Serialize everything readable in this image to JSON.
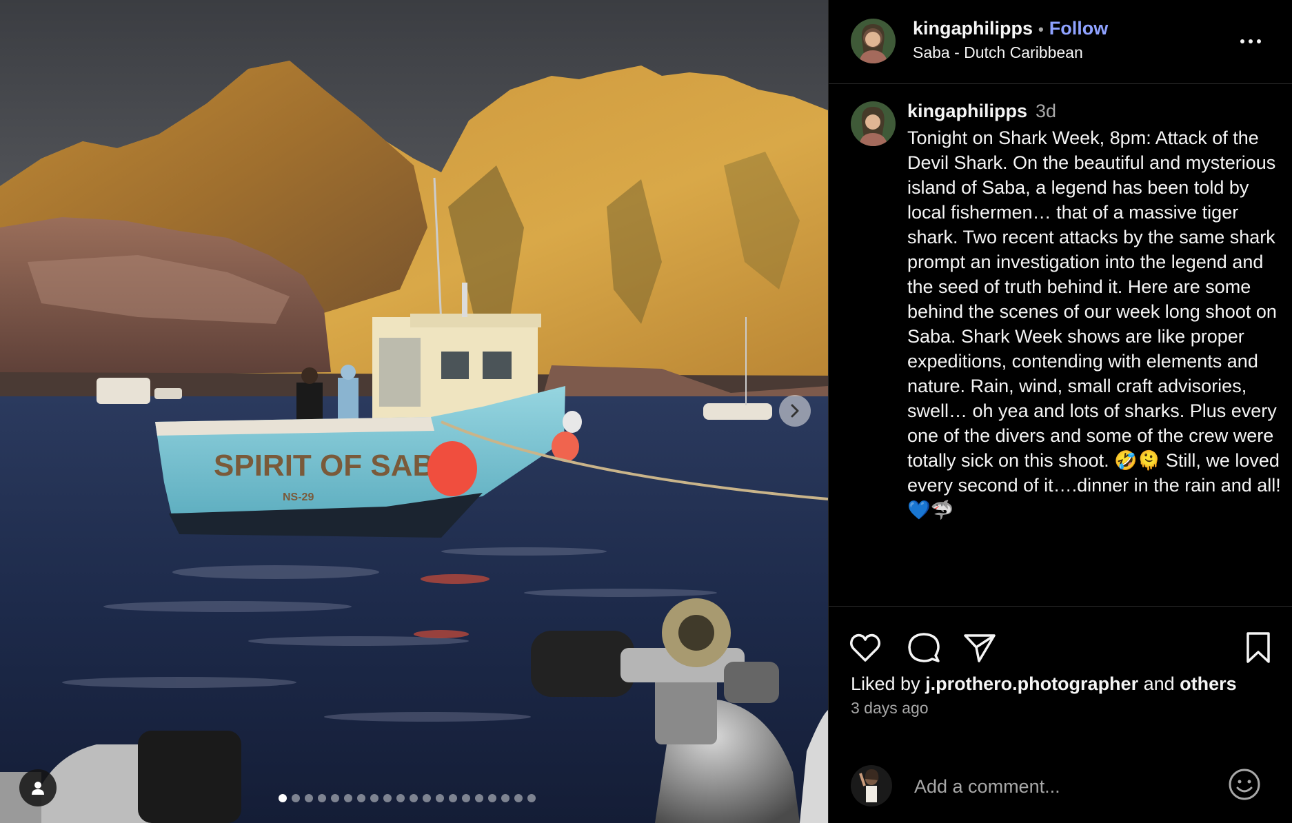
{
  "post": {
    "username": "kingaphilipps",
    "separator": "•",
    "follow_label": "Follow",
    "location": "Saba - Dutch Caribbean",
    "more_icon": "more-horizontal-icon"
  },
  "media": {
    "boat_name": "SPIRIT OF SABA",
    "boat_reg": "NS-29",
    "carousel_total": 20,
    "carousel_active_index": 0,
    "next_icon": "chevron-right-icon",
    "user_tag_icon": "person-icon"
  },
  "caption": {
    "username": "kingaphilipps",
    "timestamp": "3d",
    "text": "Tonight on Shark Week, 8pm: Attack of the Devil Shark. On the beautiful and mysterious island of Saba, a legend has been told by local fishermen… that of a massive tiger shark. Two recent attacks by the same shark prompt an investigation into the legend and the seed of truth behind it. Here are some behind the scenes of our week long shoot on Saba. Shark Week shows are like proper expeditions, contending with elements and nature. Rain, wind, small craft advisories, swell… oh yea and lots of sharks. Plus every one of the divers and some of the crew were totally sick on this shoot. 🤣🫠 Still, we loved every second of it….dinner in the rain and all! 💙🦈"
  },
  "actions": {
    "like_icon": "heart-icon",
    "comment_icon": "comment-icon",
    "share_icon": "share-icon",
    "save_icon": "bookmark-icon"
  },
  "likes": {
    "prefix": "Liked by",
    "liker": "j.prothero.photographer",
    "conjunction": "and",
    "others": "others",
    "time_ago": "3 days ago"
  },
  "comment": {
    "placeholder": "Add a comment...",
    "emoji_icon": "emoji-icon"
  },
  "colors": {
    "follow": "#8fa2ff",
    "background": "#000000",
    "secondary_text": "#a8a8a8",
    "boat_hull": "#7fc6d4",
    "buoy": "#f04e3e"
  }
}
